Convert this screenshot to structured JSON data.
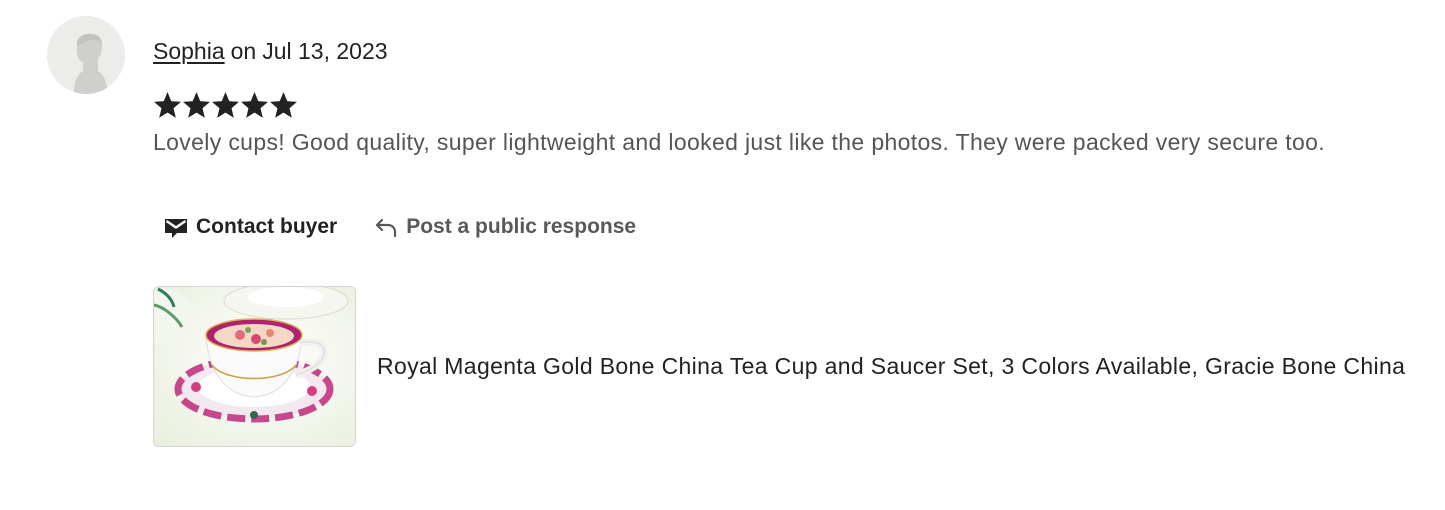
{
  "review": {
    "reviewer_name": "Sophia",
    "on_word": "on",
    "date": "Jul 13, 2023",
    "rating": 5,
    "rating_max": 5,
    "text": "Lovely cups! Good quality, super lightweight and looked just like the photos. They were packed very secure too."
  },
  "actions": {
    "contact_label": "Contact buyer",
    "contact_icon": "envelope-icon",
    "respond_label": "Post a public response",
    "respond_icon": "reply-arrow-icon"
  },
  "listing": {
    "title": "Royal Magenta Gold Bone China Tea Cup and Saucer Set, 3 Colors Available, Gracie Bone China"
  },
  "colors": {
    "text_primary": "#222222",
    "text_secondary": "#555555",
    "star": "#222222",
    "avatar_bg": "#ececea"
  }
}
